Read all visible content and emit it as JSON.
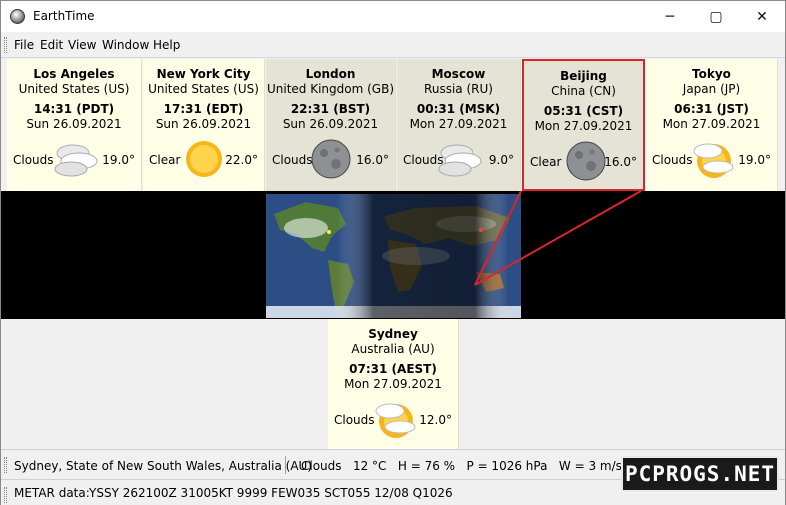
{
  "window": {
    "title": "EarthTime"
  },
  "menu": [
    "File",
    "Edit",
    "View",
    "Window",
    "Help"
  ],
  "cities": [
    {
      "name": "Los Angeles",
      "country": "United States (US)",
      "time": "14:31 (PDT)",
      "date": "Sun 26.09.2021",
      "condition": "Clouds",
      "temp": "19.0°",
      "icon": "cloud-icon",
      "night": false,
      "selected": false
    },
    {
      "name": "New York City",
      "country": "United States (US)",
      "time": "17:31 (EDT)",
      "date": "Sun 26.09.2021",
      "condition": "Clear",
      "temp": "22.0°",
      "icon": "sun-icon",
      "night": false,
      "selected": false
    },
    {
      "name": "London",
      "country": "United Kingdom (GB)",
      "time": "22:31 (BST)",
      "date": "Sun 26.09.2021",
      "condition": "Clouds",
      "temp": "16.0°",
      "icon": "moon-icon",
      "night": true,
      "selected": false
    },
    {
      "name": "Moscow",
      "country": "Russia (RU)",
      "time": "00:31 (MSK)",
      "date": "Mon 27.09.2021",
      "condition": "Clouds",
      "temp": "9.0°",
      "icon": "cloud-icon",
      "night": true,
      "selected": false
    },
    {
      "name": "Beijing",
      "country": "China (CN)",
      "time": "05:31 (CST)",
      "date": "Mon 27.09.2021",
      "condition": "Clear",
      "temp": "16.0°",
      "icon": "moon-icon",
      "night": true,
      "selected": true
    },
    {
      "name": "Tokyo",
      "country": "Japan (JP)",
      "time": "06:31 (JST)",
      "date": "Mon 27.09.2021",
      "condition": "Clouds",
      "temp": "19.0°",
      "icon": "sun-cloud-icon",
      "night": false,
      "selected": false
    },
    {
      "name": "Sydney",
      "country": "Australia (AU)",
      "time": "07:31 (AEST)",
      "date": "Mon 27.09.2021",
      "condition": "Clouds",
      "temp": "12.0°",
      "icon": "sun-cloud-icon",
      "night": false,
      "selected": false
    }
  ],
  "status": {
    "location": "Sydney, State of New South Wales, Australia (AU)",
    "weather": "Clouds   12 °C   H = 76 %   P = 1026 hPa   W = 3 m/s  ( 310° )"
  },
  "metar": {
    "label": "METAR data:",
    "value": "YSSY 262100Z 31005KT 9999 FEW035 SCT055 12/08 Q1026"
  },
  "watermark": "PCPROGS.NET",
  "colors": {
    "day_card": "#ffffe7",
    "night_card": "#e4e3d6",
    "selection": "#d6262b"
  }
}
